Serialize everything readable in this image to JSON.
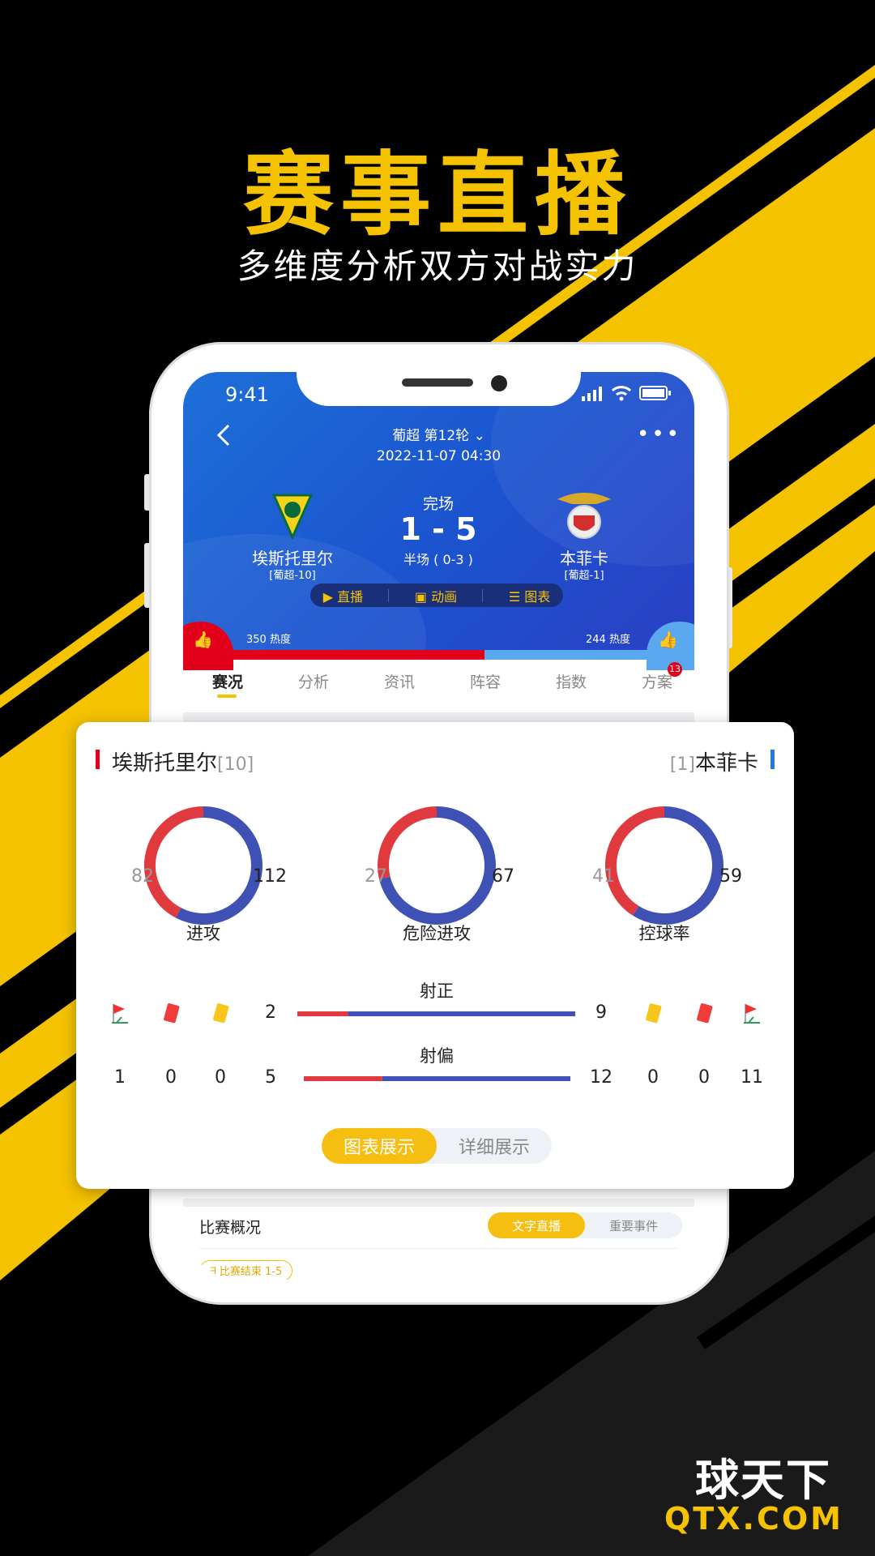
{
  "promo": {
    "title": "赛事直播",
    "subtitle": "多维度分析双方对战实力"
  },
  "status_bar": {
    "time": "9:41",
    "icons": [
      "signal-icon",
      "wifi-icon",
      "battery-icon"
    ]
  },
  "nav": {
    "league_round": "葡超 第12轮",
    "datetime": "2022-11-07 04:30"
  },
  "match": {
    "status": "完场",
    "score": "1 - 5",
    "halftime": "半场 ( 0-3 )",
    "home": {
      "name": "埃斯托里尔",
      "rank": "[葡超-10]",
      "heat": "350 热度"
    },
    "away": {
      "name": "本菲卡",
      "rank": "[葡超-1]",
      "heat": "244 热度"
    },
    "heat_home_fraction": 0.589
  },
  "media_buttons": [
    {
      "label": "直播",
      "icon": "play-icon"
    },
    {
      "label": "动画",
      "icon": "pitch-icon"
    },
    {
      "label": "图表",
      "icon": "chart-icon"
    }
  ],
  "tabs": [
    {
      "label": "赛况",
      "active": true
    },
    {
      "label": "分析"
    },
    {
      "label": "资讯"
    },
    {
      "label": "阵容"
    },
    {
      "label": "指数"
    },
    {
      "label": "方案",
      "badge": "13"
    }
  ],
  "stats_card": {
    "home_name": "埃斯托里尔",
    "home_rank": "[10]",
    "away_rank": "[1]",
    "away_name": "本菲卡",
    "colors": {
      "home": "#e03a3e",
      "away": "#3f51b5"
    },
    "donuts": [
      {
        "label": "进攻",
        "home": 82,
        "away": 112
      },
      {
        "label": "危险进攻",
        "home": 27,
        "away": 67
      },
      {
        "label": "控球率",
        "home": 41,
        "away": 59
      }
    ],
    "bars": [
      {
        "label": "射正",
        "home": 2,
        "away": 9
      },
      {
        "label": "射偏",
        "home": 5,
        "away": 12
      }
    ],
    "events": {
      "home": {
        "corners": "1",
        "red": "0",
        "yellow": "0"
      },
      "away": {
        "yellow": "0",
        "red": "0",
        "corners": "11"
      }
    },
    "toggle": {
      "active": "图表展示",
      "inactive": "详细展示"
    }
  },
  "overview": {
    "title": "比赛概况",
    "toggle_active": "文字直播",
    "toggle_inactive": "重要事件",
    "event_tag": "比赛结束 1-5"
  },
  "brand": {
    "name": "球天下",
    "domain": "QTX.COM"
  },
  "colors": {
    "accent": "#f5c200",
    "header_blue": "#1b5fd6"
  }
}
